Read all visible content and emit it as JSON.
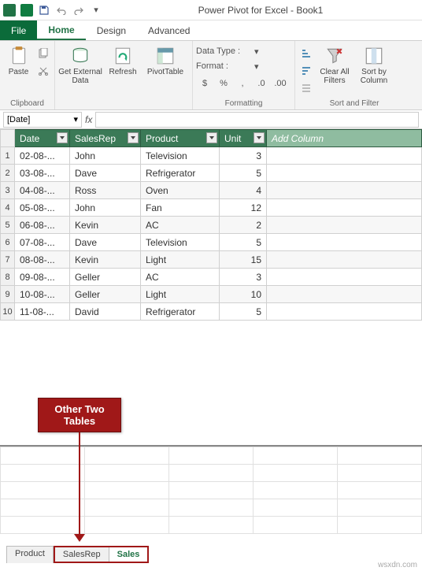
{
  "titlebar": {
    "title": "Power Pivot for Excel - Book1"
  },
  "tabs": {
    "file": "File",
    "home": "Home",
    "design": "Design",
    "advanced": "Advanced"
  },
  "ribbon": {
    "clipboard": {
      "paste": "Paste",
      "group": "Clipboard"
    },
    "getdata": {
      "label": "Get External Data",
      "refresh": "Refresh",
      "pivot": "PivotTable"
    },
    "formatting": {
      "datatype": "Data Type :",
      "format": "Format :",
      "group": "Formatting"
    },
    "sortfilter": {
      "clear": "Clear All Filters",
      "sort": "Sort by Column",
      "group": "Sort and Filter"
    }
  },
  "formulabar": {
    "name": "[Date]",
    "fx": "fx"
  },
  "columns": [
    "Date",
    "SalesRep",
    "Product",
    "Unit"
  ],
  "addcolumn": "Add Column",
  "rows": [
    {
      "n": 1,
      "date": "02-08-...",
      "rep": "John",
      "product": "Television",
      "unit": 3
    },
    {
      "n": 2,
      "date": "03-08-...",
      "rep": "Dave",
      "product": "Refrigerator",
      "unit": 5
    },
    {
      "n": 3,
      "date": "04-08-...",
      "rep": "Ross",
      "product": "Oven",
      "unit": 4
    },
    {
      "n": 4,
      "date": "05-08-...",
      "rep": "John",
      "product": "Fan",
      "unit": 12
    },
    {
      "n": 5,
      "date": "06-08-...",
      "rep": "Kevin",
      "product": "AC",
      "unit": 2
    },
    {
      "n": 6,
      "date": "07-08-...",
      "rep": "Dave",
      "product": "Television",
      "unit": 5
    },
    {
      "n": 7,
      "date": "08-08-...",
      "rep": "Kevin",
      "product": "Light",
      "unit": 15
    },
    {
      "n": 8,
      "date": "09-08-...",
      "rep": "Geller",
      "product": "AC",
      "unit": 3
    },
    {
      "n": 9,
      "date": "10-08-...",
      "rep": "Geller",
      "product": "Light",
      "unit": 10
    },
    {
      "n": 10,
      "date": "11-08-...",
      "rep": "David",
      "product": "Refrigerator",
      "unit": 5
    }
  ],
  "sheets": {
    "product": "Product",
    "salesrep": "SalesRep",
    "sales": "Sales"
  },
  "callout": "Other Two Tables",
  "watermark": "wsxdn.com"
}
